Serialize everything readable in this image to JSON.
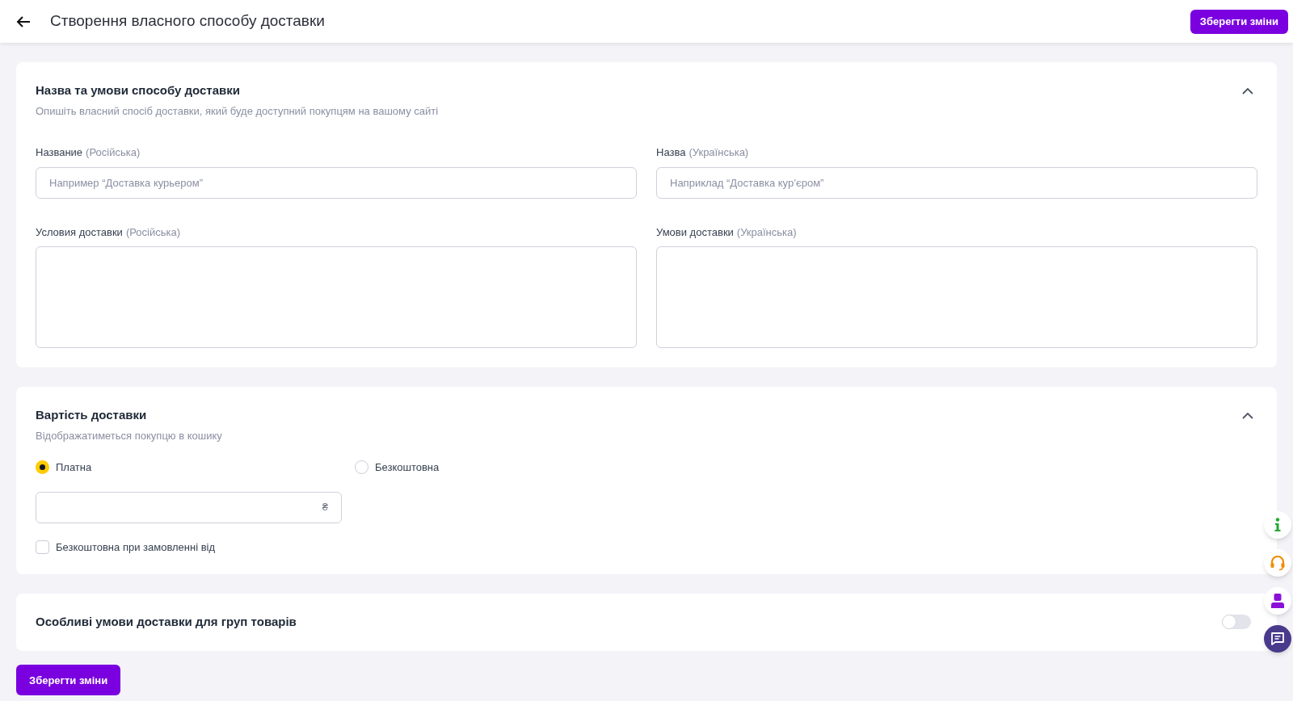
{
  "header": {
    "title": "Створення власного способу доставки",
    "save_button": "Зберегти зміни"
  },
  "sections": [
    {
      "kind": "fields",
      "title": "Назва та умови способу доставки",
      "subtitle": "Опишіть власний спосіб доставки, який буде доступний покупцям на вашому сайті",
      "expanded": true,
      "fields": [
        {
          "kind": "input",
          "label": "Название",
          "hint": "(Російська)",
          "placeholder": "Например “Доставка курьером”"
        },
        {
          "kind": "input",
          "label": "Назва",
          "hint": "(Українська)",
          "placeholder": "Наприклад “Доставка кур’єром”"
        },
        {
          "kind": "textarea",
          "label": "Условия доставки",
          "hint": "(Російська)"
        },
        {
          "kind": "textarea",
          "label": "Умови доставки",
          "hint": "(Українська)"
        }
      ]
    },
    {
      "kind": "cost",
      "title": "Вартість доставки",
      "subtitle": "Відображатиметься покупцю в кошику",
      "expanded": true,
      "options": [
        {
          "label": "Платна",
          "selected": true
        },
        {
          "label": "Безкоштовна",
          "selected": false
        }
      ],
      "price_field": {
        "currency": "₴"
      },
      "free_from": {
        "label": "Безкоштовна при замовленні від",
        "checked": false
      }
    },
    {
      "kind": "toggle",
      "title": "Особливі умови доставки для груп товарів",
      "on": false
    }
  ],
  "footer": {
    "save_button": "Зберегти зміни"
  },
  "side_buttons": [
    {
      "kind": "info"
    },
    {
      "kind": "support"
    },
    {
      "kind": "user"
    },
    {
      "kind": "chat"
    }
  ]
}
